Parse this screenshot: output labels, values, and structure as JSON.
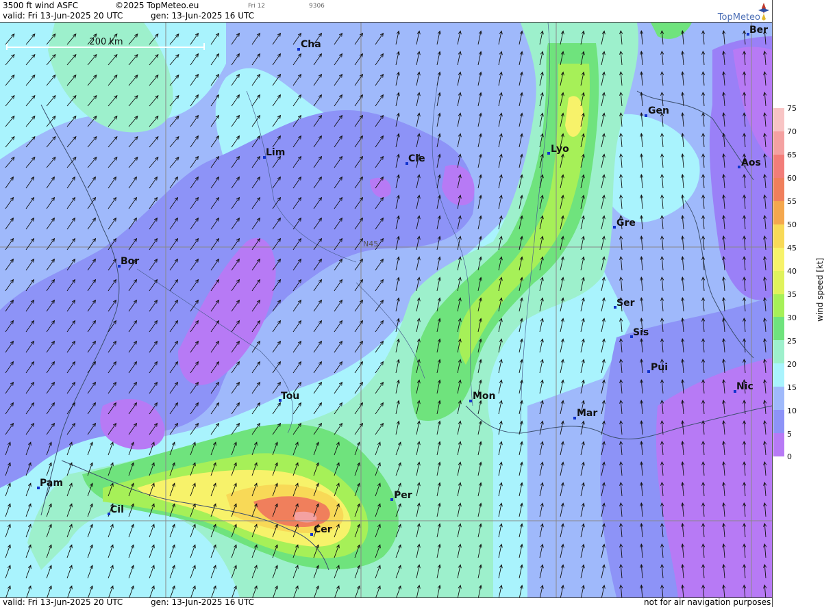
{
  "header": {
    "title": "3500 ft wind ASFC",
    "copyright": "©2025 TopMeteo.eu",
    "time_tab": "Fri 12",
    "code": "9306",
    "valid": "valid:  Fri  13-Jun-2025  20 UTC",
    "gen": "gen: 13-Jun-2025 16 UTC"
  },
  "logo": {
    "text": "TopMeteo"
  },
  "map": {
    "scale_label": "200 km",
    "lat_label": "N45",
    "cities": [
      {
        "name": "Cha"
      },
      {
        "name": "Lim"
      },
      {
        "name": "Cle"
      },
      {
        "name": "Lyo"
      },
      {
        "name": "Gen"
      },
      {
        "name": "Ber"
      },
      {
        "name": "Aos"
      },
      {
        "name": "Gre"
      },
      {
        "name": "Bor"
      },
      {
        "name": "Ser"
      },
      {
        "name": "Sis"
      },
      {
        "name": "Pui"
      },
      {
        "name": "Nic"
      },
      {
        "name": "Tou"
      },
      {
        "name": "Mon"
      },
      {
        "name": "Mar"
      },
      {
        "name": "Pam"
      },
      {
        "name": "Cil"
      },
      {
        "name": "Per"
      },
      {
        "name": "Cer"
      }
    ]
  },
  "legend": {
    "unit": "wind  speed  [kt]",
    "ticks": [
      "75",
      "70",
      "65",
      "60",
      "55",
      "50",
      "45",
      "40",
      "35",
      "30",
      "25",
      "20",
      "15",
      "10",
      "5",
      "0"
    ],
    "colors": [
      "#b77af5",
      "#9a80f7",
      "#8d93f7",
      "#9fb9fb",
      "#a9f3fd",
      "#9df0cc",
      "#6fe37d",
      "#a6f058",
      "#e0f25c",
      "#f7f26a",
      "#f8d957",
      "#f4a74d",
      "#f07f5c",
      "#f27d79",
      "#f4a1a1",
      "#f8c4c4",
      "#fbe2e2",
      "#ffffff"
    ]
  },
  "footer": {
    "valid": "valid:  Fri  13-Jun-2025  20 UTC",
    "gen": "gen: 13-Jun-2025 16 UTC",
    "note": "not for air navigation purposes"
  }
}
